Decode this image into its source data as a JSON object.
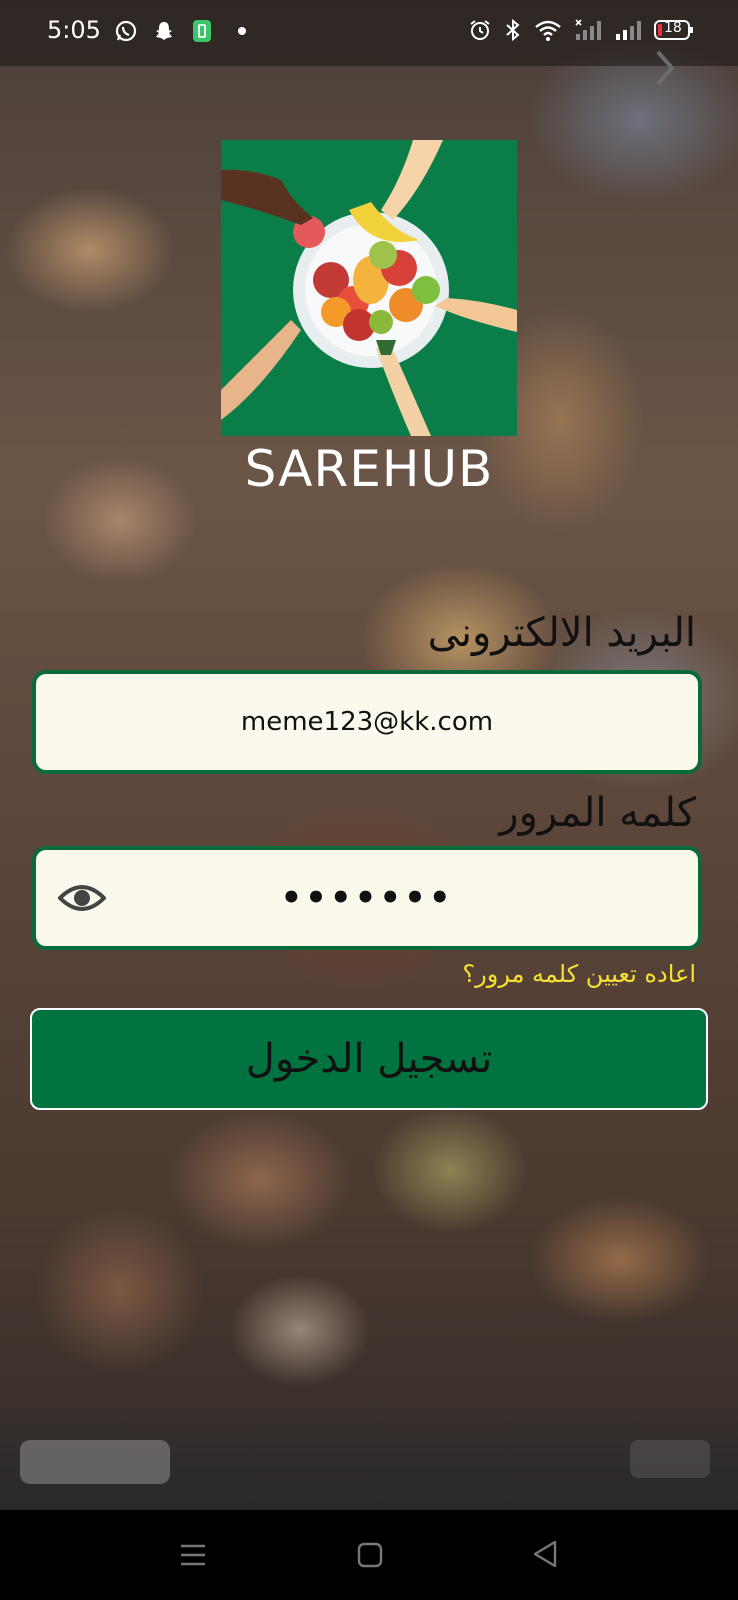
{
  "status_bar": {
    "time": "5:05",
    "battery": "18",
    "icons_left": [
      "whatsapp-icon",
      "snapchat-icon",
      "battery-saver-icon",
      "dot-icon"
    ],
    "icons_right": [
      "alarm-icon",
      "bluetooth-icon",
      "wifi-icon",
      "signal-icon",
      "signal-icon",
      "battery-icon"
    ]
  },
  "app": {
    "name": "SAREHUB",
    "brand_color": "#007341",
    "field_bg": "#fbf8ec",
    "link_color": "#f6e034"
  },
  "form": {
    "email_label": "البريد الالكترونى",
    "email_value": "meme123@kk.com",
    "password_label": "كلمه المرور",
    "password_value": "•••••••",
    "forgot_password": "اعاده تعيين كلمه مرور؟",
    "login_button": "تسجيل الدخول"
  },
  "nav_bar": {
    "icons": [
      "menu-icon",
      "home-square-icon",
      "back-triangle-icon"
    ]
  }
}
